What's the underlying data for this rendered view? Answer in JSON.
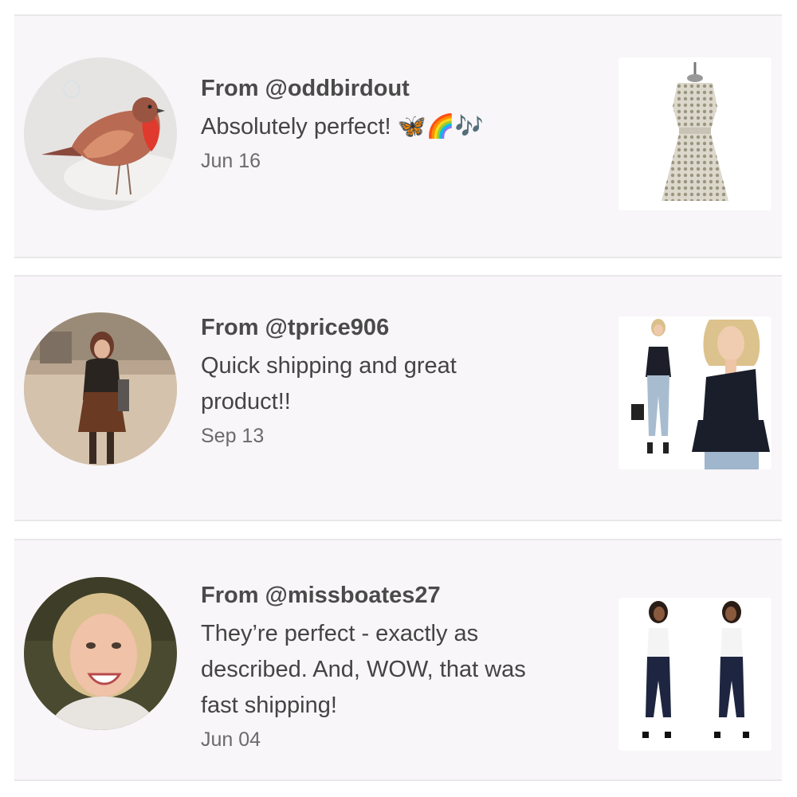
{
  "reviews": [
    {
      "from": "From @oddbirdout",
      "message": "Absolutely perfect! 🦋🌈🎶",
      "date": "Jun 16",
      "avatar_icon": "robin-bird-drawing",
      "product_icon": "patterned-dress"
    },
    {
      "from": "From @tprice906",
      "message": "Quick shipping and great product!!",
      "date": "Sep 13",
      "avatar_icon": "woman-on-rooftop-photo",
      "product_icon": "black-peplum-top-and-jeans"
    },
    {
      "from": "From @missboates27",
      "message": "They’re perfect - exactly as described. And, WOW, that was fast shipping!",
      "date": "Jun 04",
      "avatar_icon": "smiling-blonde-woman-photo",
      "product_icon": "navy-cropped-pants"
    }
  ],
  "colors": {
    "card_background": "#f8f6f8",
    "divider": "#eae7ea",
    "text": "#4a4a4a",
    "date_text": "#6b6b6b"
  }
}
